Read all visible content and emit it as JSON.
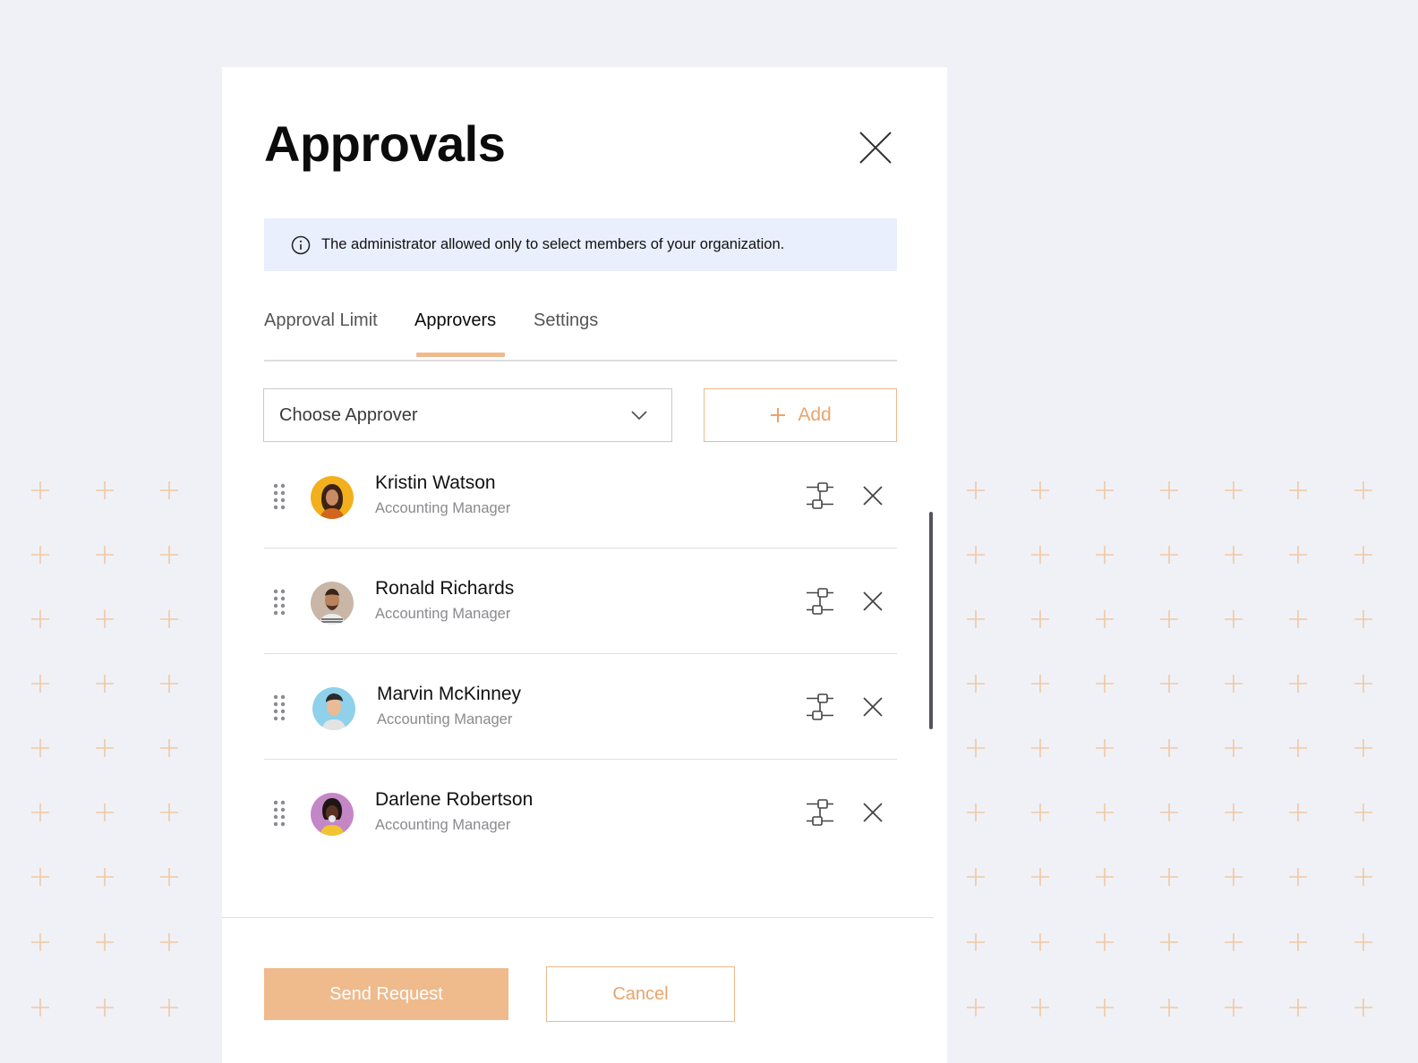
{
  "dialog": {
    "title": "Approvals",
    "close_icon": "close-icon"
  },
  "banner": {
    "icon": "info-icon",
    "text": "The administrator allowed only to select members of your organization."
  },
  "tabs": [
    {
      "label": "Approval Limit",
      "active": false
    },
    {
      "label": "Approvers",
      "active": true
    },
    {
      "label": "Settings",
      "active": false
    }
  ],
  "approver_select": {
    "value": "Choose Approver",
    "icon": "chevron-down-icon"
  },
  "add_button": {
    "label": "Add",
    "icon": "plus-icon"
  },
  "approvers": [
    {
      "name": "Kristin Watson",
      "role": "Accounting Manager"
    },
    {
      "name": "Ronald Richards",
      "role": "Accounting Manager"
    },
    {
      "name": "Marvin McKinney",
      "role": "Accounting Manager"
    },
    {
      "name": "Darlene Robertson",
      "role": "Accounting Manager"
    }
  ],
  "row_icons": {
    "drag": "drag-handle-icon",
    "flow": "workflow-icon",
    "remove": "close-icon"
  },
  "footer": {
    "send_label": "Send Request",
    "cancel_label": "Cancel"
  },
  "colors": {
    "accent": "#efba8c",
    "accent_text": "#e9a46c",
    "banner_bg": "#e9effc",
    "page_bg": "#f0f1f6",
    "pattern": "#f0c9a5"
  }
}
